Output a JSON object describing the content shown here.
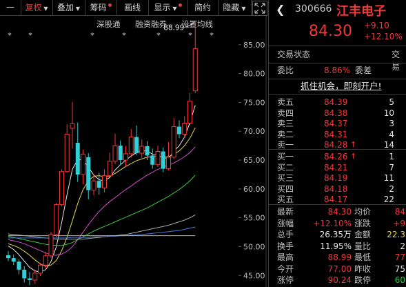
{
  "toolbar": {
    "items": [
      {
        "label": "一",
        "arrow": false,
        "dot": false,
        "active": false
      },
      {
        "label": "复权",
        "arrow": true,
        "dot": false,
        "active": true
      },
      {
        "label": "叠加",
        "arrow": true,
        "dot": false,
        "active": false
      },
      {
        "label": "筹码",
        "arrow": false,
        "dot": true,
        "active": false
      },
      {
        "label": "画线",
        "arrow": false,
        "dot": false,
        "active": false
      },
      {
        "label": "显示",
        "arrow": true,
        "dot": true,
        "active": false
      },
      {
        "label": "简约",
        "arrow": false,
        "dot": false,
        "active": false
      },
      {
        "label": "隐藏",
        "arrow": true,
        "dot": false,
        "active": false
      }
    ],
    "expand_icon": "expand-icon"
  },
  "chart_header": {
    "links": [
      "深股通",
      "融资融券",
      "设置均线"
    ]
  },
  "chart_data": {
    "type": "candlestick",
    "high_label": "88.99",
    "y_ticks": [
      85.0,
      80.0,
      75.0,
      70.0,
      65.0,
      60.0,
      55.0,
      50.0,
      45.0
    ],
    "y_tick_labels": [
      "85.00",
      "80.00",
      "75.00",
      "70.00",
      "65.00",
      "60.00",
      "55.00",
      "50.00",
      "45.00"
    ],
    "ylim": [
      43.0,
      90.0
    ],
    "candles": [
      {
        "o": 48.5,
        "c": 48.0,
        "h": 49.2,
        "l": 47.5
      },
      {
        "o": 48.0,
        "c": 47.4,
        "h": 48.6,
        "l": 46.8
      },
      {
        "o": 47.4,
        "c": 46.0,
        "h": 47.8,
        "l": 45.2
      },
      {
        "o": 46.0,
        "c": 44.5,
        "h": 46.6,
        "l": 43.8
      },
      {
        "o": 44.5,
        "c": 44.2,
        "h": 45.6,
        "l": 43.3
      },
      {
        "o": 44.2,
        "c": 45.4,
        "h": 46.0,
        "l": 43.6
      },
      {
        "o": 45.4,
        "c": 46.8,
        "h": 47.2,
        "l": 44.9
      },
      {
        "o": 46.8,
        "c": 48.4,
        "h": 49.1,
        "l": 46.2
      },
      {
        "o": 48.4,
        "c": 52.1,
        "h": 52.6,
        "l": 48.0
      },
      {
        "o": 52.1,
        "c": 57.3,
        "h": 57.6,
        "l": 51.6
      },
      {
        "o": 57.3,
        "c": 63.0,
        "h": 63.4,
        "l": 57.0
      },
      {
        "o": 63.0,
        "c": 69.5,
        "h": 71.2,
        "l": 62.8
      },
      {
        "o": 70.5,
        "c": 71.3,
        "h": 75.1,
        "l": 67.0
      },
      {
        "o": 68.0,
        "c": 62.5,
        "h": 71.5,
        "l": 61.2
      },
      {
        "o": 62.5,
        "c": 66.0,
        "h": 66.8,
        "l": 60.8
      },
      {
        "o": 65.5,
        "c": 59.8,
        "h": 66.2,
        "l": 58.2
      },
      {
        "o": 59.8,
        "c": 61.4,
        "h": 62.6,
        "l": 58.9
      },
      {
        "o": 61.4,
        "c": 60.2,
        "h": 62.8,
        "l": 59.0
      },
      {
        "o": 60.2,
        "c": 62.3,
        "h": 63.4,
        "l": 59.4
      },
      {
        "o": 62.3,
        "c": 64.8,
        "h": 66.3,
        "l": 61.8
      },
      {
        "o": 64.8,
        "c": 67.5,
        "h": 69.6,
        "l": 64.3
      },
      {
        "o": 67.5,
        "c": 65.0,
        "h": 68.4,
        "l": 64.1
      },
      {
        "o": 65.0,
        "c": 66.1,
        "h": 67.4,
        "l": 63.9
      },
      {
        "o": 66.1,
        "c": 69.0,
        "h": 70.4,
        "l": 65.5
      },
      {
        "o": 69.0,
        "c": 66.2,
        "h": 71.0,
        "l": 65.8
      },
      {
        "o": 66.2,
        "c": 67.4,
        "h": 68.6,
        "l": 65.4
      },
      {
        "o": 67.4,
        "c": 65.8,
        "h": 68.3,
        "l": 65.0
      },
      {
        "o": 65.8,
        "c": 64.2,
        "h": 67.0,
        "l": 63.5
      },
      {
        "o": 64.2,
        "c": 66.5,
        "h": 67.5,
        "l": 63.8
      },
      {
        "o": 66.5,
        "c": 63.5,
        "h": 67.2,
        "l": 62.9
      },
      {
        "o": 63.5,
        "c": 65.5,
        "h": 68.1,
        "l": 63.2
      },
      {
        "o": 65.5,
        "c": 70.8,
        "h": 72.3,
        "l": 65.2
      },
      {
        "o": 70.8,
        "c": 69.5,
        "h": 71.9,
        "l": 68.8
      },
      {
        "o": 69.5,
        "c": 71.4,
        "h": 72.6,
        "l": 68.9
      },
      {
        "o": 71.4,
        "c": 75.2,
        "h": 76.6,
        "l": 71.0
      },
      {
        "o": 77.0,
        "c": 84.3,
        "h": 88.99,
        "l": 76.6
      }
    ],
    "ma_series": [
      {
        "color": "#e8e8e8",
        "values": [
          50.1,
          49.5,
          48.6,
          47.5,
          46.4,
          45.8,
          45.6,
          46.0,
          47.4,
          50.0,
          54.2,
          59.0,
          63.4,
          65.1,
          65.0,
          63.8,
          62.4,
          61.6,
          61.4,
          62.0,
          63.3,
          64.2,
          65.0,
          65.7,
          66.3,
          66.6,
          66.6,
          66.0,
          65.8,
          65.4,
          65.3,
          66.5,
          67.5,
          69.0,
          71.5,
          74.5
        ]
      },
      {
        "color": "#e8d64a",
        "values": [
          50.5,
          50.2,
          49.8,
          49.2,
          48.5,
          47.7,
          47.0,
          46.6,
          46.8,
          47.6,
          49.3,
          51.6,
          54.5,
          57.5,
          59.9,
          61.4,
          62.2,
          62.3,
          62.1,
          62.2,
          62.7,
          63.3,
          63.9,
          64.4,
          64.9,
          65.2,
          65.5,
          65.6,
          65.6,
          65.5,
          65.6,
          66.0,
          66.6,
          67.5,
          68.8,
          70.6
        ]
      },
      {
        "color": "#d24cd2",
        "values": [
          51.2,
          51.0,
          50.8,
          50.5,
          50.1,
          49.7,
          49.3,
          48.9,
          48.6,
          48.5,
          48.7,
          49.2,
          50.0,
          51.2,
          52.5,
          53.8,
          55.0,
          56.1,
          57.0,
          57.8,
          58.5,
          59.2,
          59.9,
          60.5,
          61.2,
          61.8,
          62.4,
          62.9,
          63.4,
          63.8,
          64.1,
          64.5,
          65.0,
          65.6,
          66.3,
          67.3
        ]
      },
      {
        "color": "#3cc83c",
        "values": [
          51.8,
          51.6,
          51.4,
          51.2,
          51.0,
          50.8,
          50.6,
          50.4,
          50.3,
          50.2,
          50.2,
          50.4,
          50.7,
          51.2,
          51.7,
          52.2,
          52.7,
          53.1,
          53.5,
          53.9,
          54.3,
          54.7,
          55.1,
          55.5,
          55.9,
          56.3,
          56.7,
          57.2,
          57.7,
          58.2,
          58.7,
          59.3,
          59.9,
          60.6,
          61.4,
          62.4
        ]
      },
      {
        "color": "#aaaaaa",
        "values": [
          52.2,
          52.1,
          52.0,
          51.9,
          51.8,
          51.7,
          51.6,
          51.5,
          51.4,
          51.3,
          51.3,
          51.3,
          51.3,
          51.3,
          51.3,
          51.4,
          51.5,
          51.6,
          51.7,
          51.8,
          51.9,
          52.0,
          52.1,
          52.3,
          52.5,
          52.7,
          52.9,
          53.1,
          53.3,
          53.5,
          53.7,
          54.0,
          54.3,
          54.6,
          55.0,
          55.5
        ]
      },
      {
        "color": "#4a78d8",
        "values": [
          51.5,
          51.5,
          51.5,
          51.5,
          51.5,
          51.5,
          51.5,
          51.5,
          51.5,
          51.5,
          51.5,
          51.5,
          51.6,
          51.6,
          51.6,
          51.6,
          51.7,
          51.7,
          51.7,
          51.8,
          51.8,
          51.9,
          51.9,
          52.0,
          52.0,
          52.1,
          52.2,
          52.3,
          52.4,
          52.5,
          52.6,
          52.7,
          52.8,
          53.0,
          53.2,
          53.4
        ]
      },
      {
        "color": "#c9b87a",
        "values": [
          51.9,
          51.9,
          51.9,
          51.9,
          51.9,
          51.9,
          51.9,
          51.9,
          51.9,
          51.9,
          51.9,
          51.9,
          51.9,
          51.9,
          51.9,
          51.9,
          51.9,
          51.9,
          51.9,
          51.9,
          51.9,
          51.9,
          51.9,
          51.9,
          51.9,
          51.9,
          51.9,
          51.9,
          51.9,
          51.9,
          51.9,
          51.9,
          51.9,
          51.9,
          51.9,
          51.9
        ]
      }
    ]
  },
  "quote": {
    "code": "300666",
    "name": "江丰电子",
    "price": "84.30",
    "change": "+9.10",
    "change_pct": "+12.10%",
    "tabs": [
      "交易状态",
      "交易"
    ],
    "weibi_label": "委比",
    "weibi_value": "8.86%",
    "weicha_label": "委差",
    "banner": "抓住机会，即刻开户!",
    "sells": [
      {
        "label": "卖五",
        "price": "84.39",
        "vol": "5",
        "arrow": ""
      },
      {
        "label": "卖四",
        "price": "84.38",
        "vol": "10",
        "arrow": ""
      },
      {
        "label": "卖三",
        "price": "84.37",
        "vol": "3",
        "arrow": ""
      },
      {
        "label": "卖二",
        "price": "84.31",
        "vol": "4",
        "arrow": ""
      },
      {
        "label": "卖一",
        "price": "84.28",
        "vol": "14",
        "arrow": "↑"
      }
    ],
    "buys": [
      {
        "label": "买一",
        "price": "84.26",
        "vol": "1",
        "arrow": "↑"
      },
      {
        "label": "买二",
        "price": "84.21",
        "vol": "7",
        "arrow": ""
      },
      {
        "label": "买三",
        "price": "84.19",
        "vol": "11",
        "arrow": ""
      },
      {
        "label": "买四",
        "price": "84.18",
        "vol": "2",
        "arrow": ""
      },
      {
        "label": "买五",
        "price": "84.17",
        "vol": "22",
        "arrow": ""
      }
    ],
    "stats": [
      {
        "l1": "最新",
        "v1": "84.30",
        "c1": "red",
        "l2": "均价",
        "v2": "84",
        "c2": "red"
      },
      {
        "l1": "涨幅",
        "v1": "+12.10%",
        "c1": "red",
        "l2": "涨跌",
        "v2": "+9",
        "c2": "red"
      },
      {
        "l1": "总手",
        "v1": "26.35万",
        "c1": "white",
        "l2": "金额",
        "v2": "22.3",
        "c2": "yellow"
      },
      {
        "l1": "换手",
        "v1": "11.95%",
        "c1": "white",
        "l2": "量比",
        "v2": "2",
        "c2": "white"
      },
      {
        "l1": "最高",
        "v1": "88.99",
        "c1": "red",
        "l2": "最低",
        "v2": "77",
        "c2": "red"
      },
      {
        "l1": "今开",
        "v1": "77.00",
        "c1": "red",
        "l2": "昨收",
        "v2": "75",
        "c2": "white"
      },
      {
        "l1": "涨停",
        "v1": "90.24",
        "c1": "red",
        "l2": "跌停",
        "v2": "60",
        "c2": "green"
      }
    ]
  },
  "colors": {
    "up": "#f03838",
    "down": "#30d0d8",
    "accent": "#f03838",
    "bg": "#000000"
  }
}
